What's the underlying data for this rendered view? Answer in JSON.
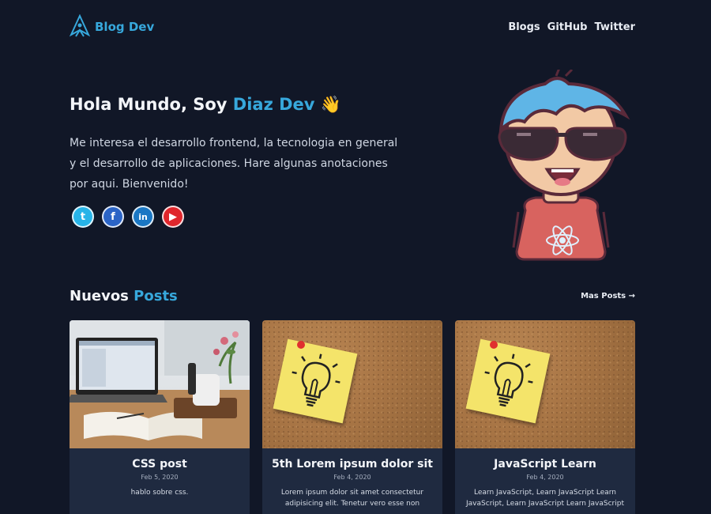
{
  "header": {
    "logo_text": "Blog Dev",
    "nav": [
      "Blogs",
      "GitHub",
      "Twitter"
    ]
  },
  "hero": {
    "title_prefix": "Hola Mundo, Soy ",
    "title_name": "Diaz Dev",
    "title_emoji": "👋",
    "description": "Me interesa el desarrollo frontend, la tecnologia en general y el desarrollo de aplicaciones. Hare algunas anotaciones por aqui. Bienvenido!",
    "socials": [
      {
        "name": "twitter",
        "glyph": "t"
      },
      {
        "name": "facebook",
        "glyph": "f"
      },
      {
        "name": "linkedin",
        "glyph": "in"
      },
      {
        "name": "youtube",
        "glyph": "▶"
      }
    ]
  },
  "posts": {
    "title_prefix": "Nuevos ",
    "title_accent": "Posts",
    "more_label": "Mas Posts →",
    "items": [
      {
        "title": "CSS post",
        "date": "Feb 5, 2020",
        "excerpt": "hablo sobre css.",
        "image": "laptop-desk"
      },
      {
        "title": "5th Lorem ipsum dolor sit",
        "date": "Feb 4, 2020",
        "excerpt": "Lorem ipsum dolor sit amet consectetur adipisicing elit. Tenetur vero esse non",
        "image": "lightbulb-note"
      },
      {
        "title": "JavaScript Learn",
        "date": "Feb 4, 2020",
        "excerpt": "Learn JavaScript, Learn JavaScript Learn JavaScript, Learn JavaScript Learn JavaScript",
        "image": "lightbulb-note"
      }
    ]
  },
  "colors": {
    "background": "#111727",
    "accent": "#37a8dc",
    "card": "#1f2a40"
  }
}
